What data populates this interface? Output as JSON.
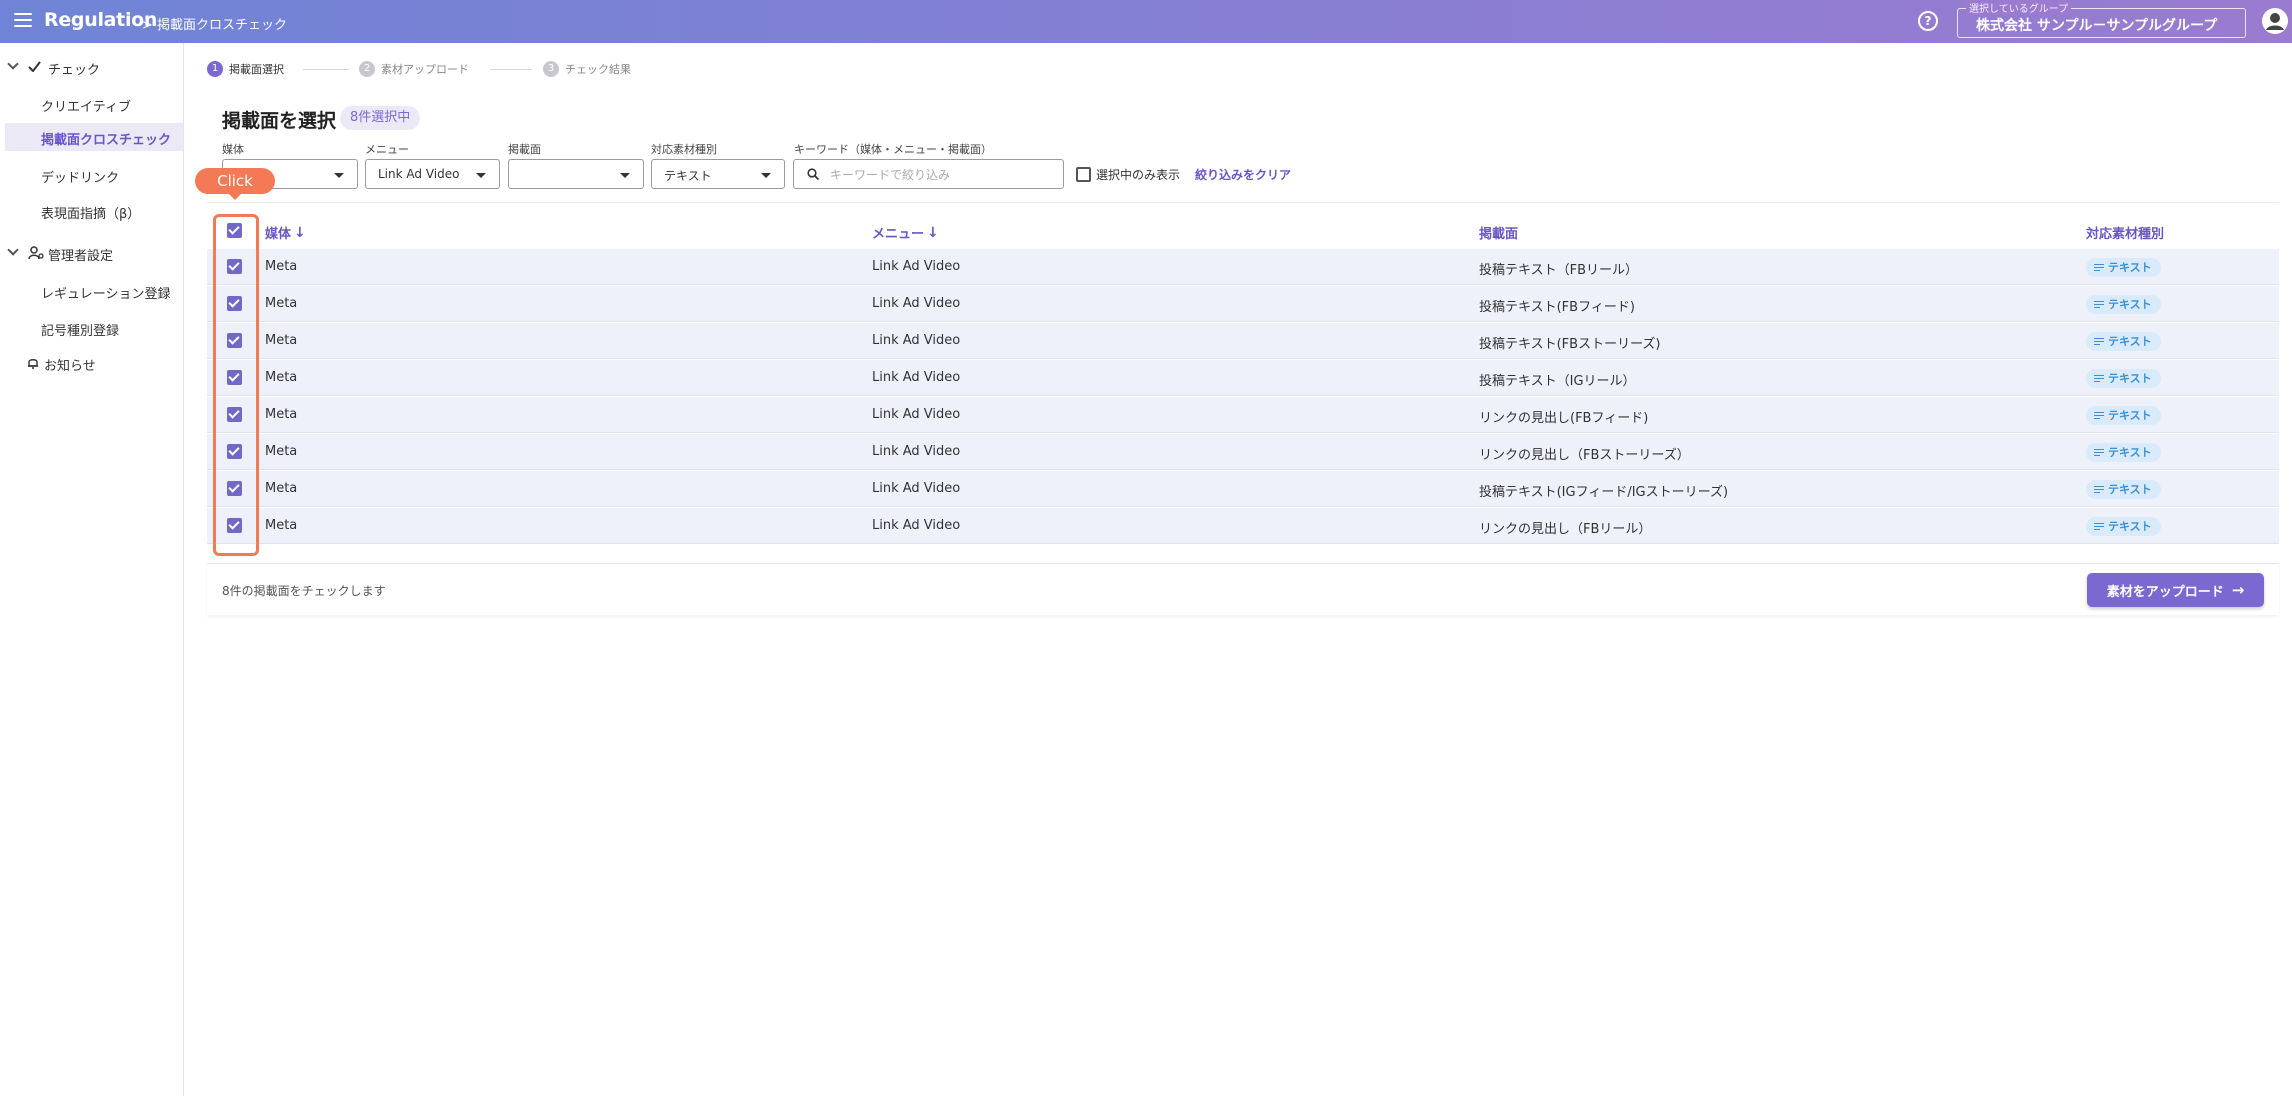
{
  "header": {
    "app_title": "Regulation",
    "breadcrumb": "> 掲載面クロスチェック",
    "help_glyph": "?",
    "group_legend": "選択しているグループ",
    "group_name": "株式会社 サンプル－サンプルグループ"
  },
  "sidebar": {
    "check_section": "チェック",
    "items": [
      "クリエイティブ",
      "掲載面クロスチェック",
      "デッドリンク",
      "表現面指摘（β）"
    ],
    "admin_section": "管理者設定",
    "admin_items": [
      "レギュレーション登録",
      "記号種別登録"
    ],
    "notice": "お知らせ"
  },
  "stepper": {
    "steps": [
      {
        "num": "1",
        "label": "掲載面選択"
      },
      {
        "num": "2",
        "label": "素材アップロード"
      },
      {
        "num": "3",
        "label": "チェック結果"
      }
    ]
  },
  "main": {
    "title": "掲載面を選択",
    "selected_badge": "8件選択中"
  },
  "filters": {
    "media_label": "媒体",
    "media_value": "",
    "menu_label": "メニュー",
    "menu_value": "Link Ad Video",
    "placement_label": "掲載面",
    "placement_value": "",
    "material_label": "対応素材種別",
    "material_value": "テキスト",
    "keyword_label": "キーワード（媒体・メニュー・掲載面）",
    "keyword_placeholder": "キーワードで絞り込み",
    "only_selected": "選択中のみ表示",
    "clear": "絞り込みをクリア"
  },
  "tooltip": "Click",
  "table": {
    "headers": {
      "media": "媒体",
      "menu": "メニュー",
      "placement": "掲載面",
      "material": "対応素材種別"
    },
    "sort_arrow": "↓",
    "rows": [
      {
        "media": "Meta",
        "menu": "Link Ad Video",
        "placement": "投稿テキスト（FBリール）",
        "material": "テキスト"
      },
      {
        "media": "Meta",
        "menu": "Link Ad Video",
        "placement": "投稿テキスト(FBフィード)",
        "material": "テキスト"
      },
      {
        "media": "Meta",
        "menu": "Link Ad Video",
        "placement": "投稿テキスト(FBストーリーズ)",
        "material": "テキスト"
      },
      {
        "media": "Meta",
        "menu": "Link Ad Video",
        "placement": "投稿テキスト（IGリール）",
        "material": "テキスト"
      },
      {
        "media": "Meta",
        "menu": "Link Ad Video",
        "placement": "リンクの見出し(FBフィード)",
        "material": "テキスト"
      },
      {
        "media": "Meta",
        "menu": "Link Ad Video",
        "placement": "リンクの見出し（FBストーリーズ）",
        "material": "テキスト"
      },
      {
        "media": "Meta",
        "menu": "Link Ad Video",
        "placement": "投稿テキスト(IGフィード/IGストーリーズ)",
        "material": "テキスト"
      },
      {
        "media": "Meta",
        "menu": "Link Ad Video",
        "placement": "リンクの見出し（FBリール）",
        "material": "テキスト"
      }
    ]
  },
  "footer": {
    "summary": "8件の掲載面をチェックします",
    "upload_button": "素材をアップロード",
    "upload_arrow": "→"
  },
  "colors": {
    "accent": "#7b68d1",
    "highlight": "#f47a56",
    "badge": "#3a8fd6"
  }
}
